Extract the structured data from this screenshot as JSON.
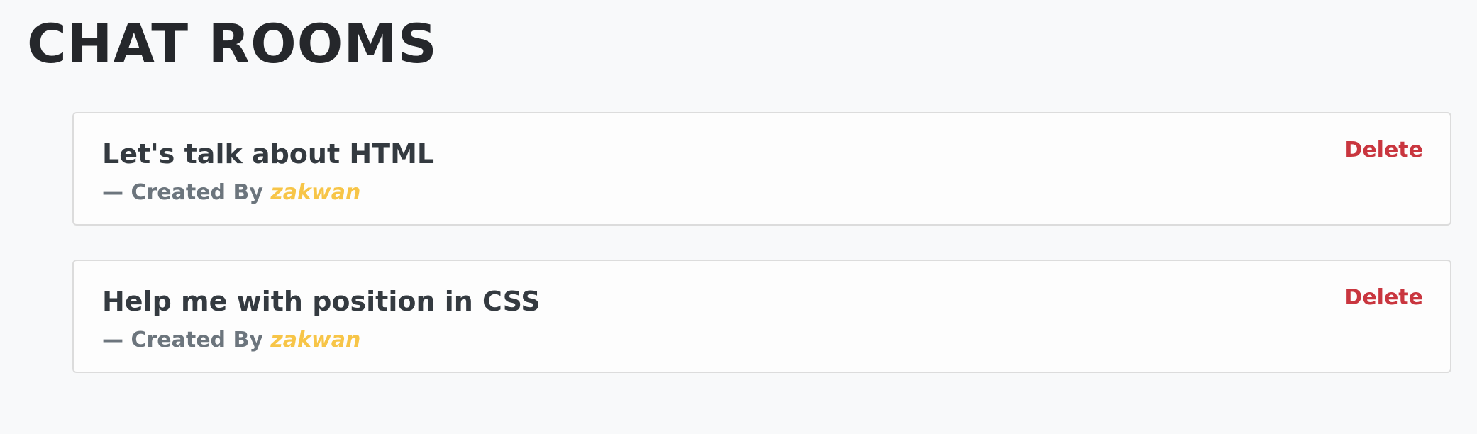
{
  "page": {
    "title": "CHAT ROOMS"
  },
  "rooms": [
    {
      "name": "Let's talk about HTML",
      "created_by_prefix": "— Created By ",
      "author": "zakwan",
      "delete_label": "Delete"
    },
    {
      "name": "Help me with position in CSS",
      "created_by_prefix": "— Created By ",
      "author": "zakwan",
      "delete_label": "Delete"
    }
  ],
  "colors": {
    "background": "#f8f9fa",
    "title": "#25272b",
    "room_name": "#343a40",
    "meta_text": "#6c757d",
    "author": "#f7c548",
    "delete": "#c9363f",
    "card_border": "#dcdcdc"
  }
}
